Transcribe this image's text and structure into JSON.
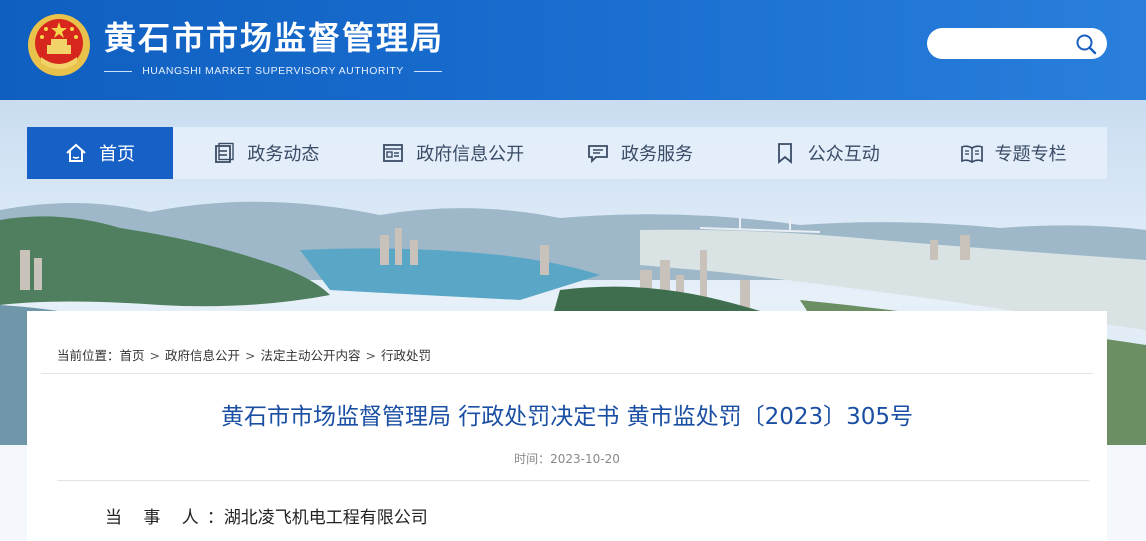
{
  "header": {
    "title": "黄石市市场监督管理局",
    "subtitle": "HUANGSHI MARKET SUPERVISORY AUTHORITY",
    "brand_color": "#1565c8",
    "search": {
      "placeholder": "",
      "icon": "search-icon"
    }
  },
  "nav": {
    "items": [
      {
        "label": "首页",
        "icon": "home-icon",
        "active": true
      },
      {
        "label": "政务动态",
        "icon": "news-icon"
      },
      {
        "label": "政府信息公开",
        "icon": "info-disclosure-icon"
      },
      {
        "label": "政务服务",
        "icon": "service-chat-icon"
      },
      {
        "label": "公众互动",
        "icon": "bookmark-icon"
      },
      {
        "label": "专题专栏",
        "icon": "open-book-icon"
      }
    ]
  },
  "breadcrumb": {
    "prefix": "当前位置：",
    "items": [
      "首页",
      "政府信息公开",
      "法定主动公开内容",
      "行政处罚"
    ],
    "separator": ">"
  },
  "article": {
    "title": "黄石市市场监督管理局 行政处罚决定书 黄市监处罚〔2023〕305号",
    "time_label": "时间：",
    "time": "2023-10-20",
    "party_label": "当 事 人",
    "party_colon": "：",
    "party_value": "湖北凌飞机电工程有限公司",
    "title_color": "#1a4fa3"
  }
}
